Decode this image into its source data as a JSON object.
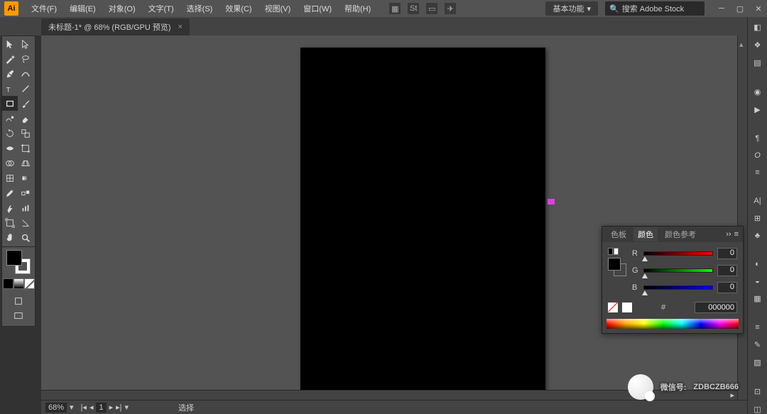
{
  "app": {
    "logo": "Ai"
  },
  "menu": {
    "items": [
      "文件(F)",
      "编辑(E)",
      "对象(O)",
      "文字(T)",
      "选择(S)",
      "效果(C)",
      "视图(V)",
      "窗口(W)",
      "帮助(H)"
    ],
    "workspace": "基本功能",
    "search_placeholder": "搜索 Adobe Stock"
  },
  "document": {
    "tab_title": "未标题-1* @ 68% (RGB/GPU 预览)"
  },
  "color_panel": {
    "tabs": [
      "色板",
      "颜色",
      "颜色参考"
    ],
    "active_tab": 1,
    "channels": [
      {
        "label": "R",
        "value": "0"
      },
      {
        "label": "G",
        "value": "0"
      },
      {
        "label": "B",
        "value": "0"
      }
    ],
    "hex_prefix": "#",
    "hex": "000000"
  },
  "status": {
    "zoom": "68%",
    "artboard_nav": "1",
    "tool_hint": "选择"
  },
  "swatches": {
    "fill": "#000000",
    "stroke": "#ffffff"
  },
  "watermark": {
    "label": "微信号:",
    "id": "ZDBCZB666"
  }
}
